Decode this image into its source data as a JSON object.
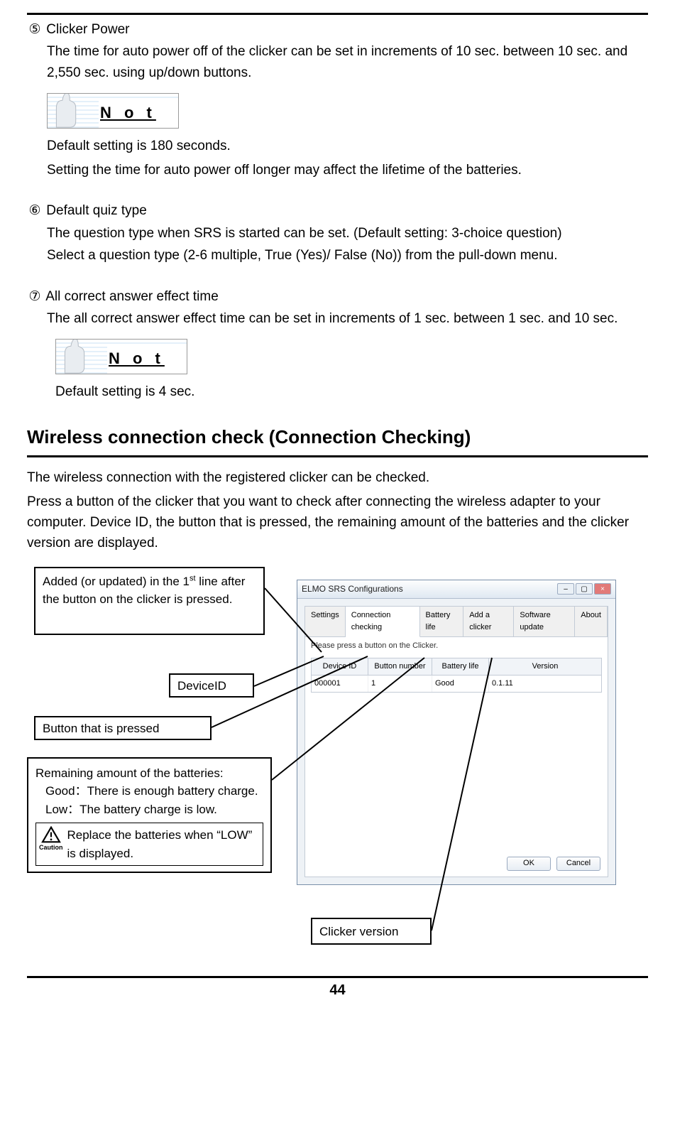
{
  "items": {
    "item5": {
      "num": "⑤",
      "title": "Clicker Power",
      "body": "The time for auto power off of the clicker can be set in increments of 10 sec. between 10 sec. and 2,550 sec. using up/down buttons."
    },
    "item6": {
      "num": "⑥",
      "title": "Default quiz type",
      "body1": "The question type when SRS is started can be set. (Default setting: 3-choice question)",
      "body2": "Select a question type (2-6 multiple, True (Yes)/ False (No)) from the pull-down menu."
    },
    "item7": {
      "num": "⑦",
      "title": "All correct answer effect time",
      "body": "The all correct answer effect time can be set in increments of 1 sec. between 1 sec. and 10 sec."
    }
  },
  "notes": {
    "label": "N o t e",
    "n1a": "Default setting is 180 seconds.",
    "n1b": "Setting the time for auto power off longer may affect the lifetime of the batteries.",
    "n2": "Default setting is 4 sec."
  },
  "heading": "Wireless connection check (Connection Checking)",
  "intro": {
    "p1": "The wireless connection with the registered clicker can be checked.",
    "p2": "Press a button of the clicker that you want to check after connecting the wireless adapter to your computer. Device ID, the button that is pressed, the remaining amount of the batteries and the clicker version are displayed."
  },
  "window": {
    "title": "ELMO SRS Configurations",
    "tabs": [
      "Settings",
      "Connection checking",
      "Battery life",
      "Add a clicker",
      "Software update",
      "About"
    ],
    "prompt": "Please press a button on the Clicker.",
    "cols": [
      "Device ID",
      "Button number",
      "Battery life",
      "Version"
    ],
    "row": [
      "000001",
      "1",
      "Good",
      "0.1.11"
    ],
    "ok": "OK",
    "cancel": "Cancel"
  },
  "callouts": {
    "added_pre": "Added (or updated) in the 1",
    "added_sup": "st",
    "added_post": " line after the button on the clicker is pressed.",
    "deviceid": "DeviceID",
    "button": "Button that is pressed",
    "remaining_title": "Remaining amount of the batteries:",
    "remaining_good": "Good：There is enough battery charge.",
    "remaining_low": "Low：The battery charge is low.",
    "caution_label": "Caution",
    "caution_text": "Replace the batteries when “LOW” is displayed.",
    "clicker_version": "Clicker version"
  },
  "page_number": "44"
}
